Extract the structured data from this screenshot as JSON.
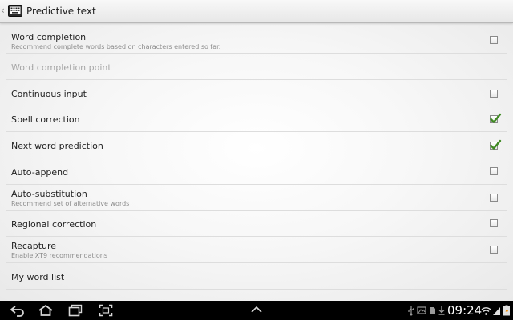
{
  "title_bar": {
    "title": "Predictive text",
    "back_icon": "chevron-left-icon",
    "app_icon": "keyboard-icon"
  },
  "settings": [
    {
      "title": "Word completion",
      "subtitle": "Recommend complete words based on characters entered so far.",
      "has_checkbox": true,
      "checked": false,
      "enabled": true
    },
    {
      "title": "Word completion point",
      "subtitle": "",
      "has_checkbox": false,
      "checked": false,
      "enabled": false
    },
    {
      "title": "Continuous input",
      "subtitle": "",
      "has_checkbox": true,
      "checked": false,
      "enabled": true
    },
    {
      "title": "Spell correction",
      "subtitle": "",
      "has_checkbox": true,
      "checked": true,
      "enabled": true
    },
    {
      "title": "Next word prediction",
      "subtitle": "",
      "has_checkbox": true,
      "checked": true,
      "enabled": true
    },
    {
      "title": "Auto-append",
      "subtitle": "",
      "has_checkbox": true,
      "checked": false,
      "enabled": true
    },
    {
      "title": "Auto-substitution",
      "subtitle": "Recommend set of alternative words",
      "has_checkbox": true,
      "checked": false,
      "enabled": true
    },
    {
      "title": "Regional correction",
      "subtitle": "",
      "has_checkbox": true,
      "checked": false,
      "enabled": true
    },
    {
      "title": "Recapture",
      "subtitle": "Enable XT9 recommendations",
      "has_checkbox": true,
      "checked": false,
      "enabled": true
    },
    {
      "title": "My word list",
      "subtitle": "",
      "has_checkbox": false,
      "checked": false,
      "enabled": true
    }
  ],
  "nav_bar": {
    "buttons": [
      "back-icon",
      "home-icon",
      "recent-apps-icon",
      "screenshot-icon",
      "chevron-up-icon"
    ],
    "status_icons": [
      "usb-icon",
      "image-icon",
      "sd-card-icon",
      "download-icon"
    ],
    "clock": "09:24",
    "system_icons": [
      "wifi-icon",
      "signal-icon",
      "battery-icon"
    ]
  },
  "colors": {
    "check_mark": "#3f8a22",
    "title_bar": "#eeeeee",
    "nav_bar": "#000000",
    "disabled_text": "#a6a6a6"
  }
}
